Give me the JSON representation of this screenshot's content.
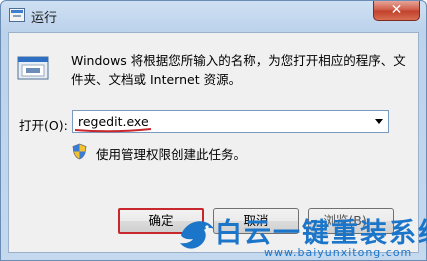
{
  "window": {
    "title": "运行",
    "close_glyph": "✕"
  },
  "dialog": {
    "description": "Windows 将根据您所输入的名称，为您打开相应的程序、文件夹、文档或 Internet 资源。",
    "open_label": "打开(O):",
    "open_value": "regedit.exe",
    "admin_note": "使用管理权限创建此任务。"
  },
  "buttons": {
    "ok": "确定",
    "cancel": "取消",
    "browse": "浏览(B)..."
  },
  "watermark": {
    "title": "白云一键重装系统",
    "url": "www.baiyunxitong.com"
  },
  "colors": {
    "highlight": "#c8282d",
    "watermark": "#1b75c9"
  },
  "icons": {
    "app": "run-dialog-icon",
    "program": "run-program-icon",
    "shield": "uac-shield-icon",
    "dropdown": "chevron-down-icon",
    "close": "close-icon",
    "watermark": "bird-logo-icon"
  }
}
